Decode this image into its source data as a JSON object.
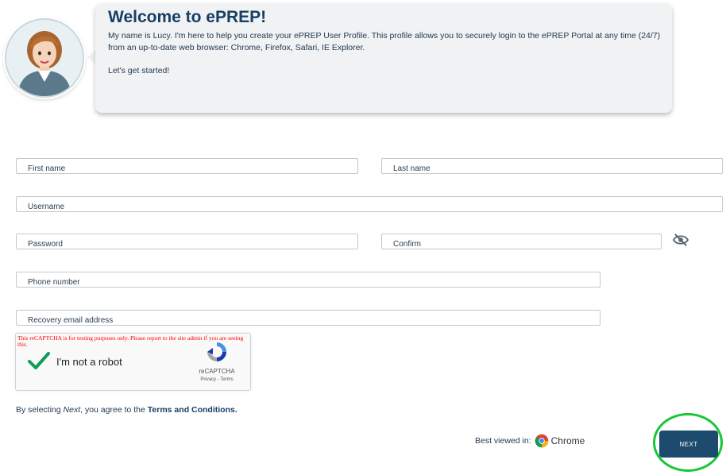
{
  "assistant": {
    "avatar_icon": "lucy-avatar",
    "title": "Welcome to ePREP!",
    "intro": "My name is Lucy. I'm here to help you create your ePREP User Profile. This profile allows you to securely login to the ePREP Portal at any time (24/7) from an up-to-date web browser: Chrome, Firefox, Safari, IE Explorer.",
    "cta": "Let's get started!"
  },
  "form": {
    "first_name": {
      "placeholder": "First name",
      "value": ""
    },
    "last_name": {
      "placeholder": "Last name",
      "value": ""
    },
    "username": {
      "placeholder": "Username",
      "value": ""
    },
    "password": {
      "placeholder": "Password",
      "value": ""
    },
    "confirm": {
      "placeholder": "Confirm",
      "value": ""
    },
    "password_visibility_icon": "eye-slash-icon",
    "phone": {
      "placeholder": "Phone number",
      "value": ""
    },
    "recovery_email": {
      "placeholder": "Recovery email address",
      "value": ""
    }
  },
  "captcha": {
    "warning": "This reCAPTCHA is for testing purposes only. Please report to the site admin if you are seeing this.",
    "label": "I'm not a robot",
    "brand": "reCAPTCHA",
    "links": "Privacy - Terms",
    "checked": true
  },
  "agreement": {
    "prefix": "By selecting ",
    "emphasis": "Next",
    "middle": ", you agree to the ",
    "link": "Terms and Conditions."
  },
  "browser_note": {
    "label": "Best viewed in:",
    "browser": "Chrome",
    "icon": "chrome-icon"
  },
  "next_button": {
    "label": "NEXT"
  },
  "colors": {
    "primary": "#1c4b6e",
    "title": "#173e64",
    "highlight_ring": "#18c636",
    "check": "#0f9d58",
    "warning": "#ff0000"
  }
}
